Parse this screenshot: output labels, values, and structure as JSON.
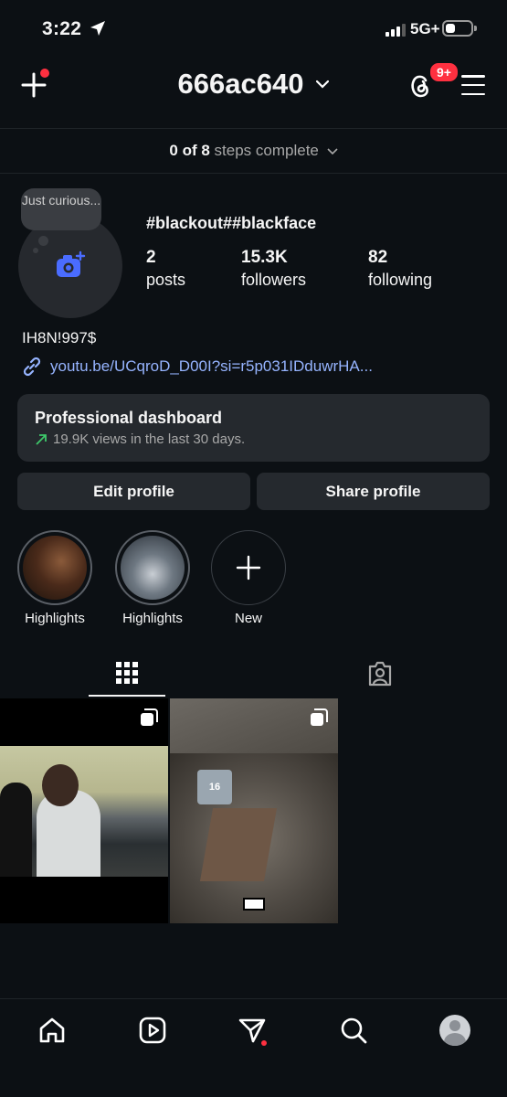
{
  "status_bar": {
    "time": "3:22",
    "network": "5G+"
  },
  "header": {
    "username": "666ac640",
    "notifications_badge": "9+"
  },
  "steps": {
    "done": "0 of 8",
    "suffix": "steps complete"
  },
  "profile": {
    "note": "Just curious...",
    "display_name": "#blackout##blackface",
    "stats": [
      {
        "value": "2",
        "label": "posts"
      },
      {
        "value": "15.3K",
        "label": "followers"
      },
      {
        "value": "82",
        "label": "following"
      }
    ],
    "bio": "IH8N!997$",
    "link": "youtu.be/UCqroD_D00I?si=r5p031IDduwrHA..."
  },
  "dashboard": {
    "title": "Professional dashboard",
    "subtitle": "19.9K views in the last 30 days."
  },
  "buttons": {
    "edit": "Edit profile",
    "share": "Share profile"
  },
  "highlights": [
    {
      "label": "Highlights"
    },
    {
      "label": "Highlights"
    },
    {
      "label": "New"
    }
  ],
  "post2_jersey_number": "16",
  "colors": {
    "background": "#0c1014",
    "accent_link": "#96b4ff",
    "badge": "#ff3040",
    "camera_icon": "#4a6cff",
    "trend_green": "#3ec96b"
  },
  "icons": [
    "create-icon",
    "chevron-down-icon",
    "threads-icon",
    "menu-icon",
    "camera-add-icon",
    "link-icon",
    "trend-up-icon",
    "plus-icon",
    "grid-icon",
    "tagged-icon",
    "home-icon",
    "reels-icon",
    "send-icon",
    "search-icon",
    "profile-avatar"
  ]
}
